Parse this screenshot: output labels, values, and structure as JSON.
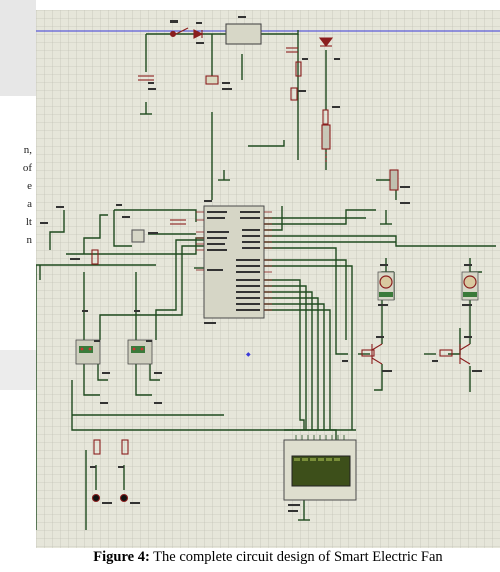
{
  "page_margin_text": {
    "fragments": [
      "n,",
      "of",
      "e",
      "a",
      "lt",
      "n"
    ]
  },
  "figure": {
    "grid_color": "#b9b9ab",
    "grid_background": "#e6e6da",
    "wire_color": "#1e4a1e",
    "component_color": "#8a1e1e",
    "power_line_color": "#3b3bd9",
    "lcd_color": "#3d4f1a"
  },
  "caption": {
    "label": "Figure 4:",
    "text": " The complete circuit design of Smart Electric Fan"
  }
}
